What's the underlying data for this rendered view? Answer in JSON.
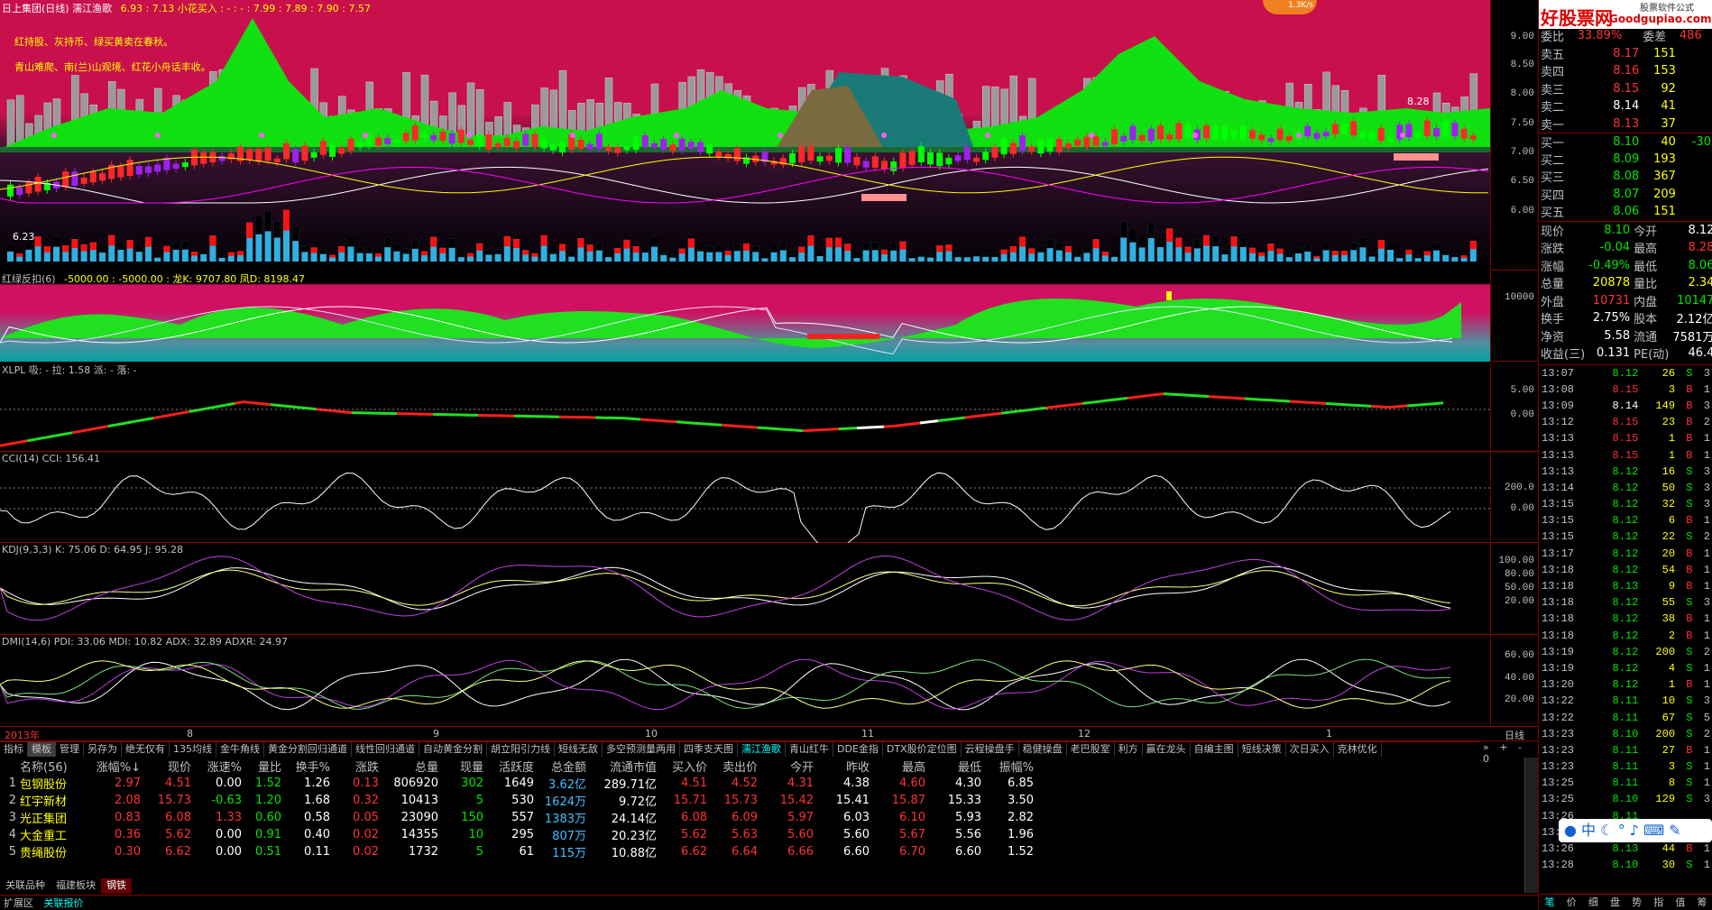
{
  "main": {
    "title": "日上集团(日线) 濡江渔歌",
    "indicators": "6.93 : 7.13 小花买入 : - : - : 7.99 : 7.89 : 7.90 : 7.57",
    "notes": [
      "红持股、灰持币、绿买黄卖在春秋。",
      "青山难爬、南(兰)山观境、红花小舟话丰收。"
    ],
    "high_label": "8.28",
    "low_label": "6.23",
    "yaxis": [
      "9.00",
      "8.50",
      "8.00",
      "7.50",
      "7.00",
      "6.50",
      "6.00"
    ]
  },
  "speed": "1.3K/s",
  "panel2": {
    "title": "红绿反扣(6)",
    "vals": "-5000.00 : -5000.00 : 龙K: 9707.80 凤D: 8198.47",
    "yaxis": [
      "10000"
    ]
  },
  "panel3": {
    "title": "XLPL 吸: - 拉: 1.58 派: - 落: -",
    "yaxis": [
      "5.00",
      "0.00"
    ]
  },
  "panel4": {
    "title": "CCI(14) CCI: 156.41",
    "yaxis": [
      "200.0",
      "0.00"
    ]
  },
  "panel5": {
    "title": "KDJ(9,3,3) K: 75.06 D: 64.95 J: 95.28",
    "yaxis": [
      "100.00",
      "80.00",
      "50.00",
      "20.00"
    ]
  },
  "panel6": {
    "title": "DMI(14,6) PDI: 33.06 MDI: 10.82 ADX: 32.89 ADXR: 24.97",
    "yaxis": [
      "60.00",
      "40.00",
      "20.00"
    ]
  },
  "timeaxis": [
    "2013年",
    "8",
    "9",
    "10",
    "11",
    "12",
    "1"
  ],
  "period": "日线",
  "tabs": [
    "指标",
    "模板",
    "管理",
    "另存为",
    "绝无仅有",
    "135均线",
    "金牛角线",
    "黄金分割回归通道",
    "线性回归通道",
    "自动黄金分割",
    "胡立阳引力线",
    "短线无敌",
    "多空预测量两用",
    "四季支天图",
    "濡江渔歌",
    "青山红牛",
    "DDE金指",
    "DTX股价定位图",
    "云程操盘手",
    "稳健操盘",
    "老巴股室",
    "利方",
    "赢在龙头",
    "自编主图",
    "短线决策",
    "次日买入",
    "克林优化"
  ],
  "grid": {
    "headers": [
      "",
      "名称(56)",
      "涨幅%↓",
      "现价",
      "涨速%",
      "量比",
      "换手%",
      "涨跌",
      "总量",
      "现量",
      "活跃度",
      "总金额",
      "流通市值",
      "买入价",
      "卖出价",
      "今开",
      "昨收",
      "最高",
      "最低",
      "振幅%"
    ],
    "rows": [
      [
        "1",
        "包钢股份",
        "2.97",
        "4.51",
        "0.00",
        "1.52",
        "1.26",
        "0.13",
        "806920",
        "302",
        "1649",
        "3.62亿",
        "289.71亿",
        "4.51",
        "4.52",
        "4.31",
        "4.38",
        "4.60",
        "4.30",
        "6.85"
      ],
      [
        "2",
        "红宇新材",
        "2.08",
        "15.73",
        "-0.63",
        "1.20",
        "1.68",
        "0.32",
        "10413",
        "5",
        "530",
        "1624万",
        "9.72亿",
        "15.71",
        "15.73",
        "15.42",
        "15.41",
        "15.87",
        "15.33",
        "3.50"
      ],
      [
        "3",
        "光正集团",
        "0.83",
        "6.08",
        "1.33",
        "0.60",
        "0.58",
        "0.05",
        "23090",
        "150",
        "557",
        "1383万",
        "24.14亿",
        "6.08",
        "6.09",
        "5.97",
        "6.03",
        "6.10",
        "5.93",
        "2.82"
      ],
      [
        "4",
        "大金重工",
        "0.36",
        "5.62",
        "0.00",
        "0.91",
        "0.40",
        "0.02",
        "14355",
        "10",
        "295",
        "807万",
        "20.23亿",
        "5.62",
        "5.63",
        "5.60",
        "5.60",
        "5.67",
        "5.56",
        "1.96"
      ],
      [
        "5",
        "贵绳股份",
        "0.30",
        "6.62",
        "0.00",
        "0.51",
        "0.11",
        "0.02",
        "1732",
        "5",
        "61",
        "115万",
        "10.88亿",
        "6.62",
        "6.64",
        "6.66",
        "6.60",
        "6.70",
        "6.60",
        "1.52"
      ]
    ]
  },
  "bottomtabs": [
    "关联品种",
    "福建板块",
    "钢铁"
  ],
  "status": [
    "扩展区",
    "关联报价"
  ],
  "right": {
    "logo": "好股票网",
    "logo_url": "Goodgupiao.com",
    "brand": "股票软件公式",
    "ratio": [
      "委比",
      "33.89%",
      "委差",
      "486"
    ],
    "asks": [
      [
        "卖五",
        "8.17",
        "151"
      ],
      [
        "卖四",
        "8.16",
        "153"
      ],
      [
        "卖三",
        "8.15",
        "92"
      ],
      [
        "卖二",
        "8.14",
        "41"
      ],
      [
        "卖一",
        "8.13",
        "37"
      ]
    ],
    "bids": [
      [
        "买一",
        "8.10",
        "40",
        "-30"
      ],
      [
        "买二",
        "8.09",
        "193",
        ""
      ],
      [
        "买三",
        "8.08",
        "367",
        ""
      ],
      [
        "买四",
        "8.07",
        "209",
        ""
      ],
      [
        "买五",
        "8.06",
        "151",
        ""
      ]
    ],
    "info": [
      [
        "现价",
        "8.10",
        "今开",
        "8.12"
      ],
      [
        "涨跌",
        "-0.04",
        "最高",
        "8.28"
      ],
      [
        "涨幅",
        "-0.49%",
        "最低",
        "8.06"
      ],
      [
        "总量",
        "20878",
        "量比",
        "2.34"
      ],
      [
        "外盘",
        "10731",
        "内盘",
        "10147"
      ],
      [
        "换手",
        "2.75%",
        "股本",
        "2.12亿"
      ],
      [
        "净资",
        "5.58",
        "流通",
        "7581万"
      ],
      [
        "收益(三)",
        "0.131",
        "PE(动)",
        "46.4"
      ]
    ],
    "ticks": [
      [
        "13:07",
        "8.12",
        "26",
        "S",
        "3"
      ],
      [
        "13:08",
        "8.15",
        "3",
        "B",
        "1"
      ],
      [
        "13:09",
        "8.14",
        "149",
        "B",
        "3"
      ],
      [
        "13:12",
        "8.15",
        "23",
        "B",
        "2"
      ],
      [
        "13:13",
        "8.15",
        "1",
        "B",
        "1"
      ],
      [
        "13:13",
        "8.15",
        "1",
        "B",
        "1"
      ],
      [
        "13:13",
        "8.12",
        "16",
        "S",
        "3"
      ],
      [
        "13:14",
        "8.12",
        "50",
        "S",
        "3"
      ],
      [
        "13:15",
        "8.12",
        "32",
        "S",
        "3"
      ],
      [
        "13:15",
        "8.12",
        "6",
        "B",
        "1"
      ],
      [
        "13:15",
        "8.12",
        "22",
        "S",
        "2"
      ],
      [
        "13:17",
        "8.12",
        "20",
        "B",
        "1"
      ],
      [
        "13:18",
        "8.12",
        "54",
        "B",
        "1"
      ],
      [
        "13:18",
        "8.13",
        "9",
        "B",
        "1"
      ],
      [
        "13:18",
        "8.12",
        "55",
        "S",
        "3"
      ],
      [
        "13:18",
        "8.12",
        "38",
        "B",
        "1"
      ],
      [
        "13:18",
        "8.12",
        "2",
        "B",
        "1"
      ],
      [
        "13:19",
        "8.12",
        "200",
        "S",
        "2"
      ],
      [
        "13:19",
        "8.12",
        "4",
        "S",
        "1"
      ],
      [
        "13:20",
        "8.12",
        "1",
        "B",
        "1"
      ],
      [
        "13:22",
        "8.11",
        "10",
        "S",
        "3"
      ],
      [
        "13:22",
        "8.11",
        "67",
        "S",
        "5"
      ],
      [
        "13:23",
        "8.10",
        "200",
        "S",
        "2"
      ],
      [
        "13:23",
        "8.11",
        "27",
        "B",
        "1"
      ],
      [
        "13:23",
        "8.11",
        "3",
        "S",
        "1"
      ],
      [
        "13:25",
        "8.11",
        "8",
        "S",
        "1"
      ],
      [
        "13:25",
        "8.10",
        "129",
        "S",
        "3"
      ],
      [
        "13:26",
        "8.11",
        "",
        "",
        ""
      ],
      [
        "13:26",
        "8.11",
        "",
        "",
        ""
      ],
      [
        "13:26",
        "8.13",
        "44",
        "B",
        "1"
      ],
      [
        "13:28",
        "8.10",
        "30",
        "S",
        "1"
      ]
    ],
    "bottom": [
      "笔",
      "价",
      "细",
      "盘",
      "势",
      "指",
      "值",
      "筹"
    ]
  }
}
